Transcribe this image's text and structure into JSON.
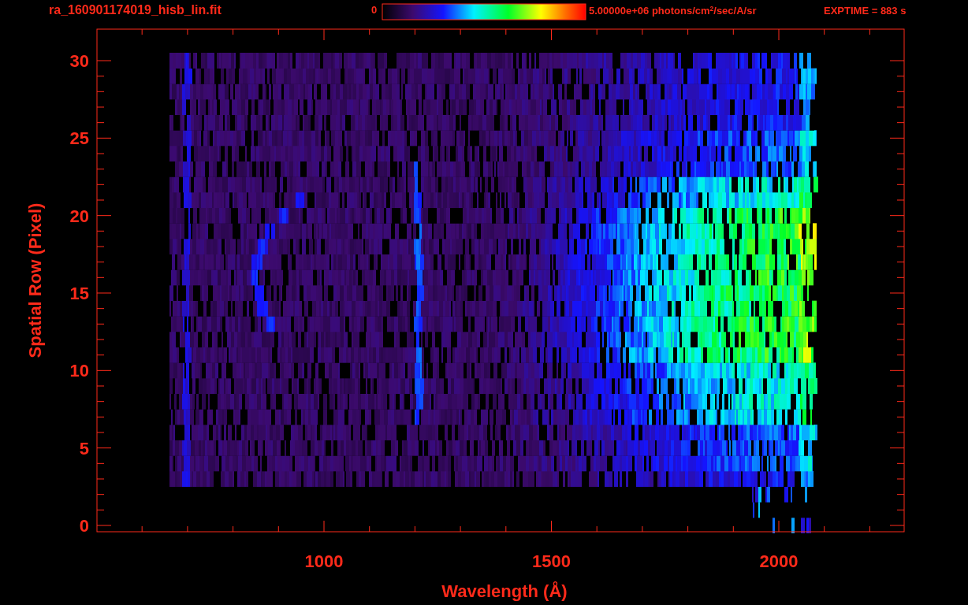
{
  "title": "ra_160901174019_hisb_lin.fit",
  "colorbar": {
    "min_label": "0",
    "max_label": "5.00000e+06 photons/cm$^{2}$/sec/A/sr"
  },
  "exposure": "EXPTIME = 883 s",
  "x_axis": {
    "label": "Wavelength (Å)",
    "tick_labels": [
      "1000",
      "1500",
      "2000"
    ]
  },
  "y_axis": {
    "label": "Spatial Row (Pixel)",
    "tick_labels": [
      "30",
      "25",
      "20",
      "15",
      "10",
      "5",
      "0"
    ]
  }
}
